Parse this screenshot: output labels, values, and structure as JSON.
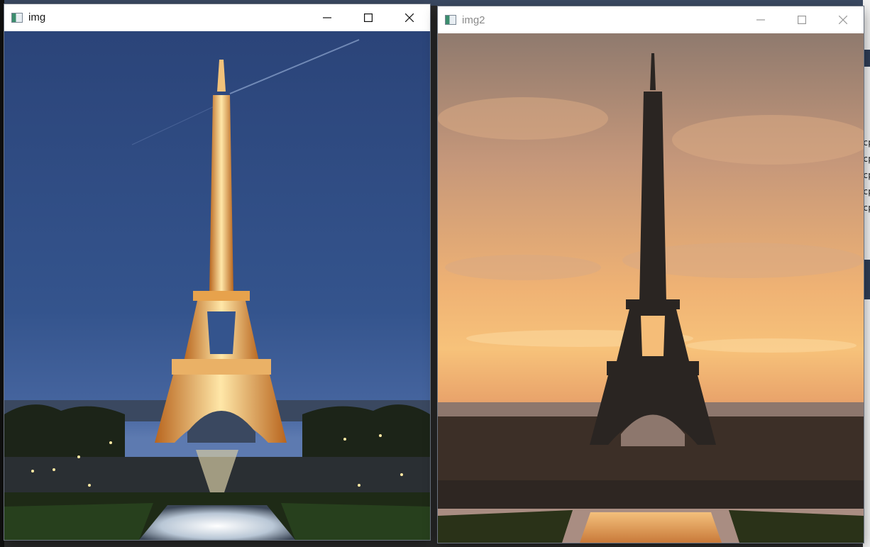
{
  "windows": [
    {
      "title": "img",
      "state": "active",
      "controls": [
        "minimize-icon",
        "maximize-icon",
        "close-icon"
      ],
      "image": "eiffel-tower-night"
    },
    {
      "title": "img2",
      "state": "inactive",
      "controls": [
        "minimize-icon",
        "maximize-icon",
        "close-icon"
      ],
      "image": "eiffel-tower-sunset"
    }
  ],
  "background": {
    "right_edge_text": [
      "cp",
      "cp",
      "cp",
      "cp",
      "cp"
    ]
  },
  "colors": {
    "night_sky": "#2f4e86",
    "sunset_sky": "#f0b46a"
  }
}
